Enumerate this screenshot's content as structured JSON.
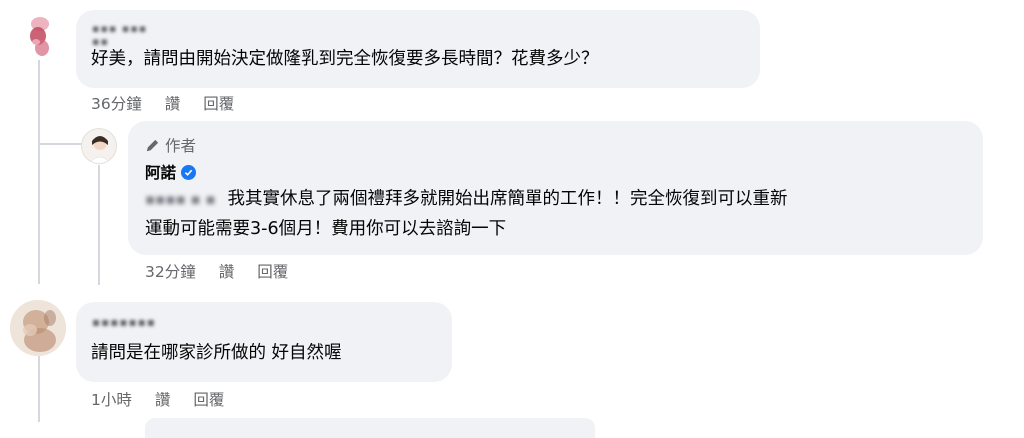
{
  "comments": [
    {
      "text": "好美，請問由開始決定做隆乳到完全恢復要多長時間？花費多少？",
      "time": "36分鐘",
      "like_label": "讚",
      "reply_label": "回覆",
      "reply": {
        "author_tag": "作者",
        "author_name": "阿諾",
        "text_line1": "我其實休息了兩個禮拜多就開始出席簡單的工作！！完全恢復到可以重新",
        "text_line2": "運動可能需要3-6個月！費用你可以去諮詢一下",
        "time": "32分鐘",
        "like_label": "讚",
        "reply_label": "回覆"
      }
    },
    {
      "text": "請問是在哪家診所做的 好自然喔",
      "time": "1小時",
      "like_label": "讚",
      "reply_label": "回覆"
    }
  ],
  "colors": {
    "bubble_bg": "#f0f2f5",
    "meta_text": "#65676b",
    "verified_badge": "#1877f2",
    "thread_line": "#d5d8dd"
  },
  "icons": [
    "pen-icon",
    "verified-badge-icon"
  ]
}
